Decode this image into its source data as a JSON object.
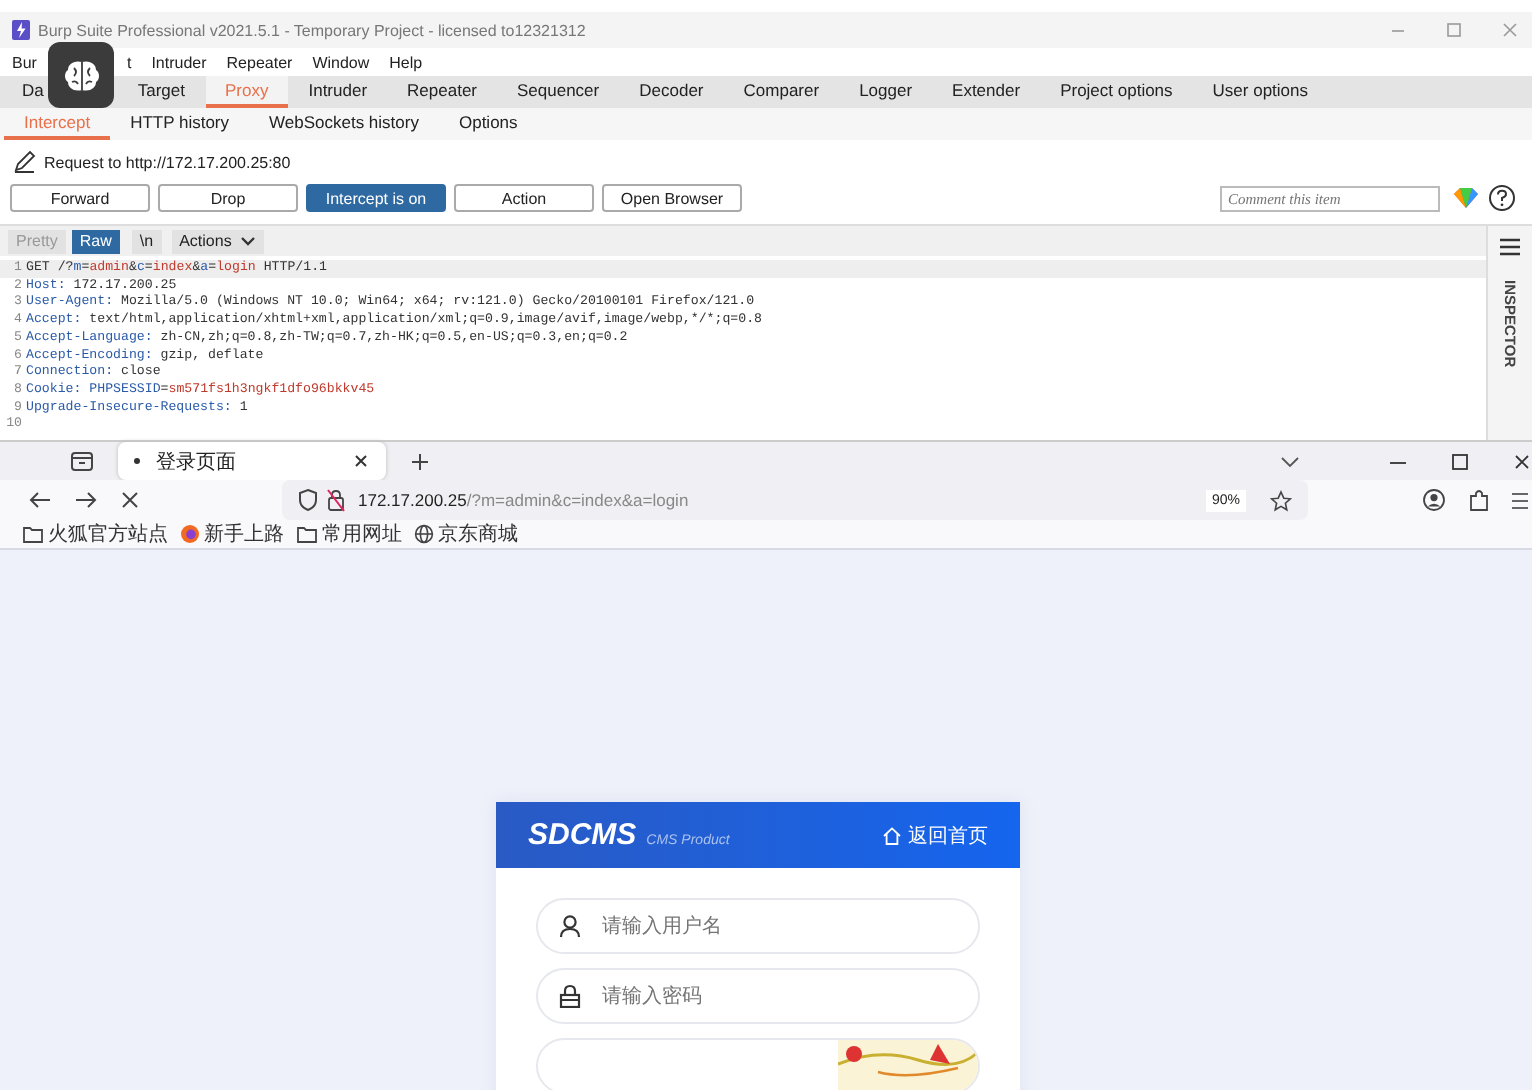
{
  "burp": {
    "title": "Burp Suite Professional v2021.5.1 - Temporary Project - licensed to12321312",
    "menu": [
      "Bur",
      "t",
      "Intruder",
      "Repeater",
      "Window",
      "Help"
    ],
    "tabs": [
      {
        "label": "Da",
        "selected": false
      },
      {
        "label": "Target",
        "selected": false
      },
      {
        "label": "Proxy",
        "selected": true
      },
      {
        "label": "Intruder",
        "selected": false
      },
      {
        "label": "Repeater",
        "selected": false
      },
      {
        "label": "Sequencer",
        "selected": false
      },
      {
        "label": "Decoder",
        "selected": false
      },
      {
        "label": "Comparer",
        "selected": false
      },
      {
        "label": "Logger",
        "selected": false
      },
      {
        "label": "Extender",
        "selected": false
      },
      {
        "label": "Project options",
        "selected": false
      },
      {
        "label": "User options",
        "selected": false
      }
    ],
    "subtabs": [
      {
        "label": "Intercept",
        "selected": true
      },
      {
        "label": "HTTP history",
        "selected": false
      },
      {
        "label": "WebSockets history",
        "selected": false
      },
      {
        "label": "Options",
        "selected": false
      }
    ],
    "request_to": "Request to http://172.17.200.25:80",
    "buttons": [
      {
        "label": "Forward",
        "selected": false
      },
      {
        "label": "Drop",
        "selected": false
      },
      {
        "label": "Intercept is on",
        "selected": true
      },
      {
        "label": "Action",
        "selected": false
      },
      {
        "label": "Open Browser",
        "selected": false
      }
    ],
    "comment": {
      "placeholder": "Comment this item"
    },
    "editor_tabs": [
      {
        "label": "Pretty",
        "selected": false
      },
      {
        "label": "Raw",
        "selected": true
      },
      {
        "label": "\\n",
        "selected": false
      },
      {
        "label": "Actions",
        "selected": false
      }
    ],
    "lines": [
      {
        "num": "1",
        "parts": [
          {
            "text": "GET /?",
            "kind": "plain"
          },
          {
            "text": "m",
            "kind": "name"
          },
          {
            "text": "=",
            "kind": "plain"
          },
          {
            "text": "admin",
            "kind": "param"
          },
          {
            "text": "&",
            "kind": "plain"
          },
          {
            "text": "c",
            "kind": "name"
          },
          {
            "text": "=",
            "kind": "plain"
          },
          {
            "text": "index",
            "kind": "param"
          },
          {
            "text": "&",
            "kind": "plain"
          },
          {
            "text": "a",
            "kind": "name"
          },
          {
            "text": "=",
            "kind": "plain"
          },
          {
            "text": "login",
            "kind": "param"
          },
          {
            "text": " HTTP/1.1",
            "kind": "plain"
          }
        ]
      },
      {
        "num": "2",
        "parts": [
          {
            "text": "Host:",
            "kind": "name"
          },
          {
            "text": " 172.17.200.25",
            "kind": "plain"
          }
        ]
      },
      {
        "num": "3",
        "parts": [
          {
            "text": "User-Agent:",
            "kind": "name"
          },
          {
            "text": " Mozilla/5.0 (Windows NT 10.0; Win64; x64; rv:121.0) Gecko/20100101 Firefox/121.0",
            "kind": "plain"
          }
        ]
      },
      {
        "num": "4",
        "parts": [
          {
            "text": "Accept:",
            "kind": "name"
          },
          {
            "text": " text/html,application/xhtml+xml,application/xml;q=0.9,image/avif,image/webp,*/*;q=0.8",
            "kind": "plain"
          }
        ]
      },
      {
        "num": "5",
        "parts": [
          {
            "text": "Accept-Language:",
            "kind": "name"
          },
          {
            "text": " zh-CN,zh;q=0.8,zh-TW;q=0.7,zh-HK;q=0.5,en-US;q=0.3,en;q=0.2",
            "kind": "plain"
          }
        ]
      },
      {
        "num": "6",
        "parts": [
          {
            "text": "Accept-Encoding:",
            "kind": "name"
          },
          {
            "text": " gzip, deflate",
            "kind": "plain"
          }
        ]
      },
      {
        "num": "7",
        "parts": [
          {
            "text": "Connection:",
            "kind": "name"
          },
          {
            "text": " close",
            "kind": "plain"
          }
        ]
      },
      {
        "num": "8",
        "parts": [
          {
            "text": "Cookie:",
            "kind": "name"
          },
          {
            "text": " PHPSESSID",
            "kind": "name"
          },
          {
            "text": "=",
            "kind": "plain"
          },
          {
            "text": "sm571fs1h3ngkf1dfo96bkkv45",
            "kind": "param"
          }
        ]
      },
      {
        "num": "9",
        "parts": [
          {
            "text": "Upgrade-Insecure-Requests:",
            "kind": "name"
          },
          {
            "text": " 1",
            "kind": "plain"
          }
        ]
      },
      {
        "num": "10"
      }
    ],
    "inspector": "INSPECTOR"
  },
  "browser": {
    "tab": {
      "title": "登录页面",
      "selected": true
    },
    "url": {
      "host": "172.17.200.25",
      "path": "/?m=admin&c=index&a=login"
    },
    "zoom": "90%",
    "bookmarks": [
      {
        "label": "火狐官方站点",
        "kind": "folder"
      },
      {
        "label": "新手上路",
        "kind": "fox"
      },
      {
        "label": "常用网址",
        "kind": "folder"
      },
      {
        "label": "京东商城",
        "kind": "globe"
      }
    ]
  },
  "login": {
    "logo": "SDCMS",
    "logo_sub": "CMS Product",
    "home_link": "返回首页",
    "fields": [
      {
        "placeholder": "请输入用户名",
        "kind": "user"
      },
      {
        "placeholder": "请输入密码",
        "kind": "lock"
      },
      {
        "kind": "captcha"
      }
    ]
  }
}
